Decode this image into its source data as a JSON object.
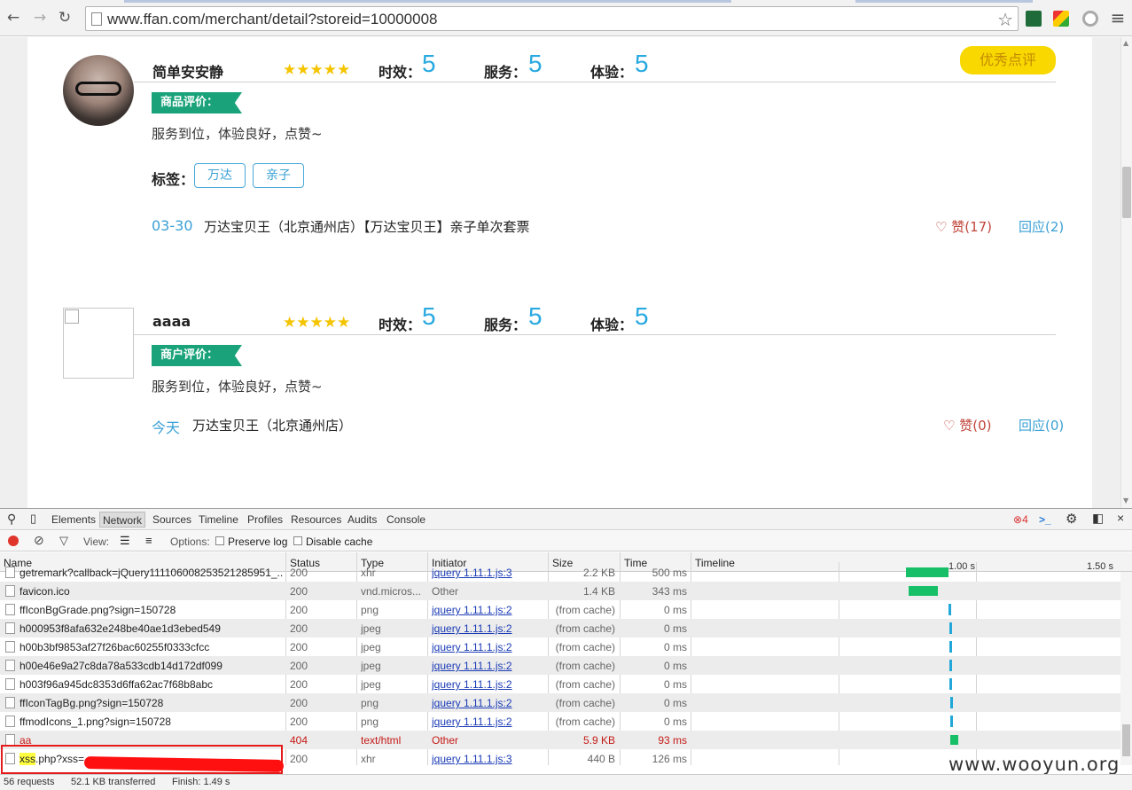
{
  "browser": {
    "url": "www.ffan.com/merchant/detail?storeid=10000008",
    "back_icon": "←",
    "forward_icon": "→",
    "reload_icon": "↻",
    "star_icon": "☆",
    "menu_icon": "≡"
  },
  "reviews": [
    {
      "username": "简单安安静",
      "stars": "★★★★★",
      "scores": [
        {
          "label": "时效：",
          "value": "5"
        },
        {
          "label": "服务：",
          "value": "5"
        },
        {
          "label": "体验：",
          "value": "5"
        }
      ],
      "badge": "优秀点评",
      "section_label": "商品评价：",
      "comment": "服务到位，体验良好，点赞~",
      "tags_label": "标签：",
      "tags": [
        "万达",
        "亲子"
      ],
      "date": "03-30",
      "store": "万达宝贝王（北京通州店）【万达宝贝王】亲子单次套票",
      "like": "赞(17)",
      "reply": "回应(2)"
    },
    {
      "username": "aaaa",
      "stars": "★★★★★",
      "scores": [
        {
          "label": "时效：",
          "value": "5"
        },
        {
          "label": "服务：",
          "value": "5"
        },
        {
          "label": "体验：",
          "value": "5"
        }
      ],
      "section_label": "商户评价：",
      "comment": "服务到位，体验良好，点赞~",
      "date": "今天",
      "store": "万达宝贝王（北京通州店）",
      "like": "赞(0)",
      "reply": "回应(0)"
    }
  ],
  "devtools": {
    "tabs": [
      "Elements",
      "Network",
      "Sources",
      "Timeline",
      "Profiles",
      "Resources",
      "Audits",
      "Console"
    ],
    "active_tab": "Network",
    "error_count": "4",
    "view_label": "View:",
    "options_label": "Options:",
    "preserve_log": "Preserve log",
    "disable_cache": "Disable cache",
    "columns": [
      "Name",
      "Status",
      "Type",
      "Initiator",
      "Size",
      "Time",
      "Timeline"
    ],
    "timeline_ticks": [
      "1.00 s",
      "1.50 s"
    ],
    "rows": [
      {
        "name": "getremark?callback=jQuery111106008253521285951_...",
        "status": "200",
        "type": "xhr",
        "initiator": "jquery 1.11.1.js:3",
        "size": "2.2 KB",
        "time": "500 ms",
        "bar": "green",
        "bar_start": 0.96,
        "bar_end": 1.115
      },
      {
        "name": "favicon.ico",
        "status": "200",
        "type": "vnd.micros...",
        "initiator": "Other",
        "size": "1.4 KB",
        "time": "343 ms",
        "bar": "green",
        "bar_start": 0.97,
        "bar_end": 1.075
      },
      {
        "name": "ffIconBgGrade.png?sign=150728",
        "status": "200",
        "type": "png",
        "initiator": "jquery 1.11.1.js:2",
        "size": "(from cache)",
        "time": "0 ms",
        "bar": "blue",
        "bar_start": 1.115
      },
      {
        "name": "h000953f8afa632e248be40ae1d3ebed549",
        "status": "200",
        "type": "jpeg",
        "initiator": "jquery 1.11.1.js:2",
        "size": "(from cache)",
        "time": "0 ms",
        "bar": "blue",
        "bar_start": 1.116
      },
      {
        "name": "h00b3bf9853af27f26bac60255f0333cfcc",
        "status": "200",
        "type": "jpeg",
        "initiator": "jquery 1.11.1.js:2",
        "size": "(from cache)",
        "time": "0 ms",
        "bar": "blue",
        "bar_start": 1.117
      },
      {
        "name": "h00e46e9a27c8da78a533cdb14d172df099",
        "status": "200",
        "type": "jpeg",
        "initiator": "jquery 1.11.1.js:2",
        "size": "(from cache)",
        "time": "0 ms",
        "bar": "blue",
        "bar_start": 1.118
      },
      {
        "name": "h003f96a945dc8353d6ffa62ac7f68b8abc",
        "status": "200",
        "type": "jpeg",
        "initiator": "jquery 1.11.1.js:2",
        "size": "(from cache)",
        "time": "0 ms",
        "bar": "blue",
        "bar_start": 1.119
      },
      {
        "name": "ffIconTagBg.png?sign=150728",
        "status": "200",
        "type": "png",
        "initiator": "jquery 1.11.1.js:2",
        "size": "(from cache)",
        "time": "0 ms",
        "bar": "blue",
        "bar_start": 1.12
      },
      {
        "name": "ffmodIcons_1.png?sign=150728",
        "status": "200",
        "type": "png",
        "initiator": "jquery 1.11.1.js:2",
        "size": "(from cache)",
        "time": "0 ms",
        "bar": "blue",
        "bar_start": 1.121
      },
      {
        "name": "aa",
        "status": "404",
        "type": "text/html",
        "initiator": "Other",
        "size": "5.9 KB",
        "time": "93 ms",
        "bar": "green",
        "bar_start": 1.122,
        "bar_end": 1.151,
        "error": true
      },
      {
        "name_hl": "xss",
        "name": ".php?xss=",
        "status": "200",
        "type": "xhr",
        "initiator": "jquery 1.11.1.js:3",
        "size": "440 B",
        "time": "126 ms"
      }
    ],
    "summary": [
      "56 requests",
      "52.1 KB transferred",
      "Finish: 1.49 s"
    ]
  },
  "watermark": "www.wooyun.org",
  "colors": {
    "accent_blue": "#28a9e0",
    "tag_green": "#1aa37a",
    "badge_yellow": "#f9d800",
    "error_red": "#c41a16"
  }
}
